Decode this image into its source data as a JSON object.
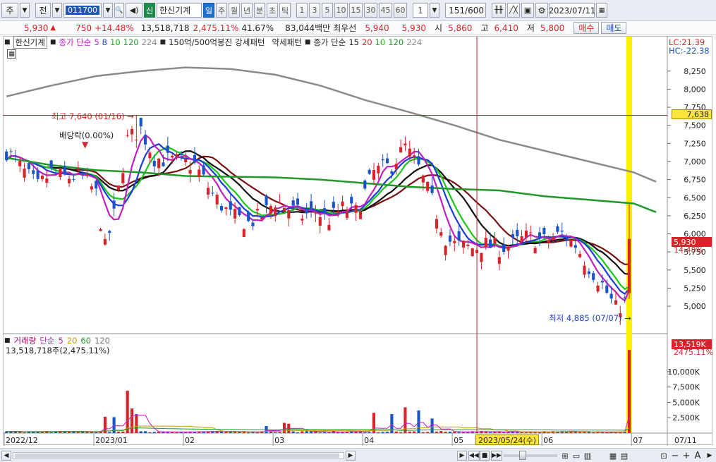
{
  "toolbar": {
    "type_label": "주",
    "prev_label": "전",
    "code": "011700",
    "badge": "신",
    "stock_name": "한신기계",
    "periods": [
      "일",
      "주",
      "월",
      "년",
      "분",
      "초",
      "틱"
    ],
    "active_period": "일",
    "minutes": [
      "1",
      "3",
      "5",
      "10",
      "15",
      "30",
      "45",
      "60"
    ],
    "interval_value": "1",
    "count_value": "151",
    "count_total": "/600",
    "date_value": "2023/07/11"
  },
  "quote": {
    "price": "5,930",
    "arrow": "▲",
    "change": "750",
    "change_pct": "+14.48%",
    "volume": "13,518,718",
    "volume_ratio": "2,475.11%",
    "turnover": "41.67%",
    "amount": "83,044백만",
    "best_label": "최우선",
    "best_ask": "5,940",
    "best_bid": "5,930",
    "open_label": "시",
    "open": "5,860",
    "high_label": "고",
    "high": "6,410",
    "low_label": "저",
    "low": "5,800",
    "buy_label": "매수",
    "sell_label": "매도"
  },
  "legend": {
    "stock": "한신기계",
    "ma_title": "종가 단순",
    "ma_periods": [
      "5",
      "8",
      "10",
      "120",
      "224"
    ],
    "pattern1": "150억/500억봉진",
    "pattern2": "강세패턴",
    "pattern3": "약세패턴",
    "ma2_title": "종가 단순",
    "ma2_periods": [
      "15",
      "20",
      "10",
      "120",
      "224"
    ]
  },
  "volume_legend": {
    "title": "거래량",
    "ma_title": "단순",
    "periods": [
      "5",
      "20",
      "60",
      "120"
    ],
    "current": "13,518,718주(2,475.11%)"
  },
  "annotations": {
    "high": "최고 7,640 (01/16)",
    "dividend": "배당락(0.00%)",
    "low": "최저 4,885 (07/07)",
    "lc": "LC:21.39",
    "hc": "HC:-22.38",
    "high_line_value": "7,638",
    "last_price": "5,930",
    "last_pct": "14.48%",
    "last_volume": "13,519K",
    "last_vol_pct": "2475.11%",
    "cursor_date": "2023/05/24(수)"
  },
  "colors": {
    "up": "#d8232a",
    "down": "#1a54c8",
    "ma5": "#c020c0",
    "ma8": "#1a3cd8",
    "ma10": "#18c818",
    "ma15": "#111111",
    "ma20": "#7a1010",
    "ma120": "#1f9a2a",
    "ma224": "#8a8a8a",
    "highlight": "#fff000"
  },
  "chart_data": {
    "type": "candlestick",
    "ylim": [
      4650,
      8550
    ],
    "yticks": [
      5000,
      5250,
      5500,
      5750,
      6000,
      6250,
      6500,
      6750,
      7000,
      7250,
      7500,
      7750,
      8000,
      8250
    ],
    "ytick_labels": [
      "5,000",
      "5,250",
      "5,500",
      "5,750",
      "6,000",
      "6,250",
      "6,500",
      "6,750",
      "7,000",
      "7,250",
      "7,500",
      "7,750",
      "8,000",
      "8,250"
    ],
    "xlabels": [
      "2022/12",
      "2023/01",
      "02",
      "03",
      "04",
      "05",
      "06",
      "07",
      "07/11"
    ],
    "high_line": 7638,
    "ma120_points": [
      [
        0,
        7050
      ],
      [
        10,
        6950
      ],
      [
        20,
        6880
      ],
      [
        30,
        6850
      ],
      [
        40,
        6800
      ],
      [
        50,
        6790
      ],
      [
        60,
        6780
      ],
      [
        70,
        6750
      ],
      [
        80,
        6700
      ],
      [
        90,
        6650
      ],
      [
        100,
        6620
      ],
      [
        110,
        6600
      ],
      [
        120,
        6520
      ],
      [
        130,
        6470
      ],
      [
        140,
        6420
      ],
      [
        145,
        6300
      ]
    ],
    "ma224_points": [
      [
        0,
        7900
      ],
      [
        10,
        8050
      ],
      [
        20,
        8180
      ],
      [
        30,
        8250
      ],
      [
        40,
        8300
      ],
      [
        50,
        8280
      ],
      [
        60,
        8200
      ],
      [
        70,
        8050
      ],
      [
        80,
        7850
      ],
      [
        90,
        7680
      ],
      [
        100,
        7500
      ],
      [
        110,
        7300
      ],
      [
        120,
        7150
      ],
      [
        130,
        7000
      ],
      [
        140,
        6850
      ],
      [
        145,
        6720
      ]
    ],
    "volume": {
      "ylim": [
        0,
        14000
      ],
      "yticks": [
        2500,
        5000,
        7500,
        10000
      ],
      "ytick_labels": [
        "2,500K",
        "5,000K",
        "7,500K",
        "10,000K"
      ],
      "last": 13519
    }
  }
}
